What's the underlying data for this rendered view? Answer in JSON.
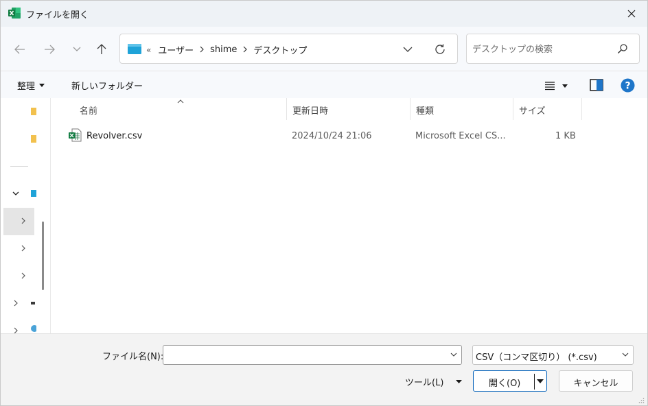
{
  "window": {
    "title": "ファイルを開く",
    "colors": {
      "excel_green": "#1d6f42",
      "accent": "#005fb8",
      "folder_yellow": "#f2c14e",
      "folder_blue": "#1fa3d8"
    }
  },
  "address": {
    "overflow": "«",
    "crumbs": [
      "ユーザー",
      "shime",
      "デスクトップ"
    ]
  },
  "search": {
    "placeholder": "デスクトップの検索"
  },
  "toolbar": {
    "organize_label": "整理",
    "new_folder_label": "新しいフォルダー"
  },
  "columns": {
    "name": "名前",
    "modified": "更新日時",
    "type": "種類",
    "size": "サイズ"
  },
  "files": [
    {
      "name": "Revolver.csv",
      "modified": "2024/10/24 21:06",
      "type": "Microsoft Excel CS...",
      "size": "1 KB"
    }
  ],
  "footer": {
    "filename_label": "ファイル名(N):",
    "filename_value": "",
    "filetype_selected": "CSV（コンマ区切り） (*.csv)",
    "tools_label": "ツール(L)",
    "open_label": "開く(O)",
    "cancel_label": "キャンセル"
  },
  "icons": {
    "app": "excel-icon",
    "close": "close-icon",
    "back": "back-arrow-icon",
    "forward": "forward-arrow-icon",
    "recent": "chevron-down-icon",
    "up": "up-arrow-icon",
    "refresh": "refresh-icon",
    "search": "search-icon",
    "view": "list-view-icon",
    "preview": "preview-pane-icon",
    "help": "help-icon"
  }
}
